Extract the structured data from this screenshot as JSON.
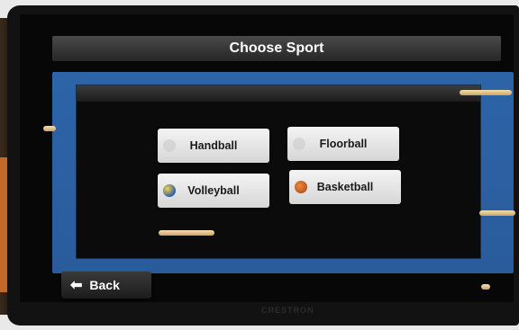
{
  "header": {
    "title": "Choose Sport"
  },
  "sports": {
    "handball": {
      "label": "Handball",
      "icon": "handball-ball-icon"
    },
    "floorball": {
      "label": "Floorball",
      "icon": "floorball-ball-icon"
    },
    "volleyball": {
      "label": "Volleyball",
      "icon": "volleyball-icon"
    },
    "basketball": {
      "label": "Basketball",
      "icon": "basketball-icon"
    }
  },
  "footer": {
    "back_label": "Back",
    "back_icon": "back-arrow-icon"
  },
  "device": {
    "brand": "CRESTRON"
  },
  "colors": {
    "frame_blue": "#2d64a8",
    "button_face": "#e6e6e6",
    "title_bar": "#333333"
  }
}
